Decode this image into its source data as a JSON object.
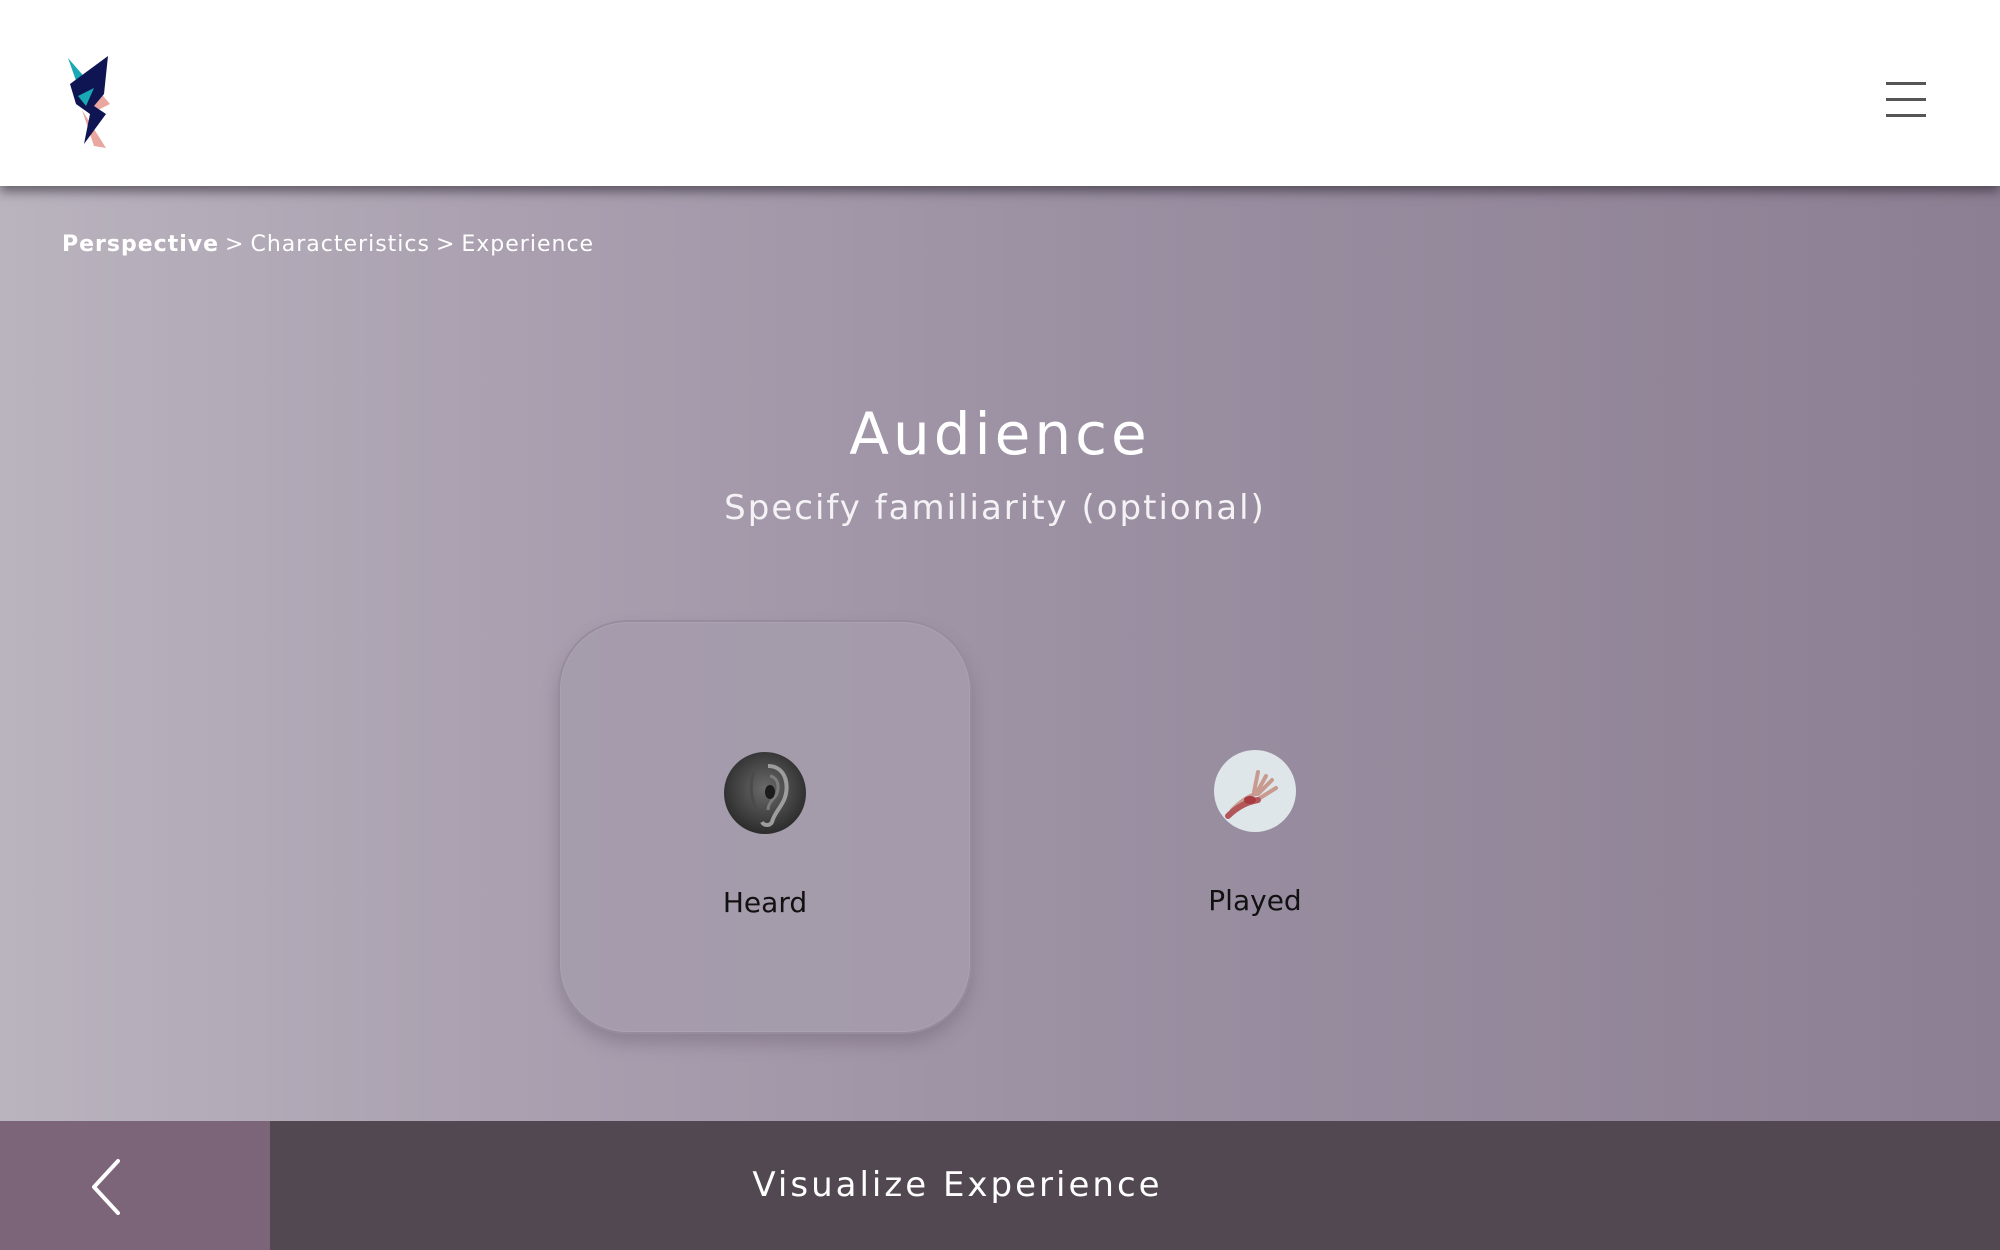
{
  "header": {
    "logo_icon": "lightning-bolt-logo",
    "menu_icon": "hamburger-menu-icon"
  },
  "breadcrumb": {
    "items": [
      "Perspective",
      "Characteristics",
      "Experience"
    ],
    "separator": ">"
  },
  "main": {
    "title": "Audience",
    "subtitle": "Specify familiarity (optional)",
    "options": [
      {
        "label": "Heard",
        "icon": "ear-image",
        "selected": true
      },
      {
        "label": "Played",
        "icon": "hand-image",
        "selected": false
      }
    ]
  },
  "footer": {
    "back_icon": "chevron-left-icon",
    "action_label": "Visualize Experience"
  },
  "colors": {
    "header_bg": "#ffffff",
    "footer_bg": "#524851",
    "back_button_bg": "#7c6479",
    "text_light": "#ffffff"
  }
}
